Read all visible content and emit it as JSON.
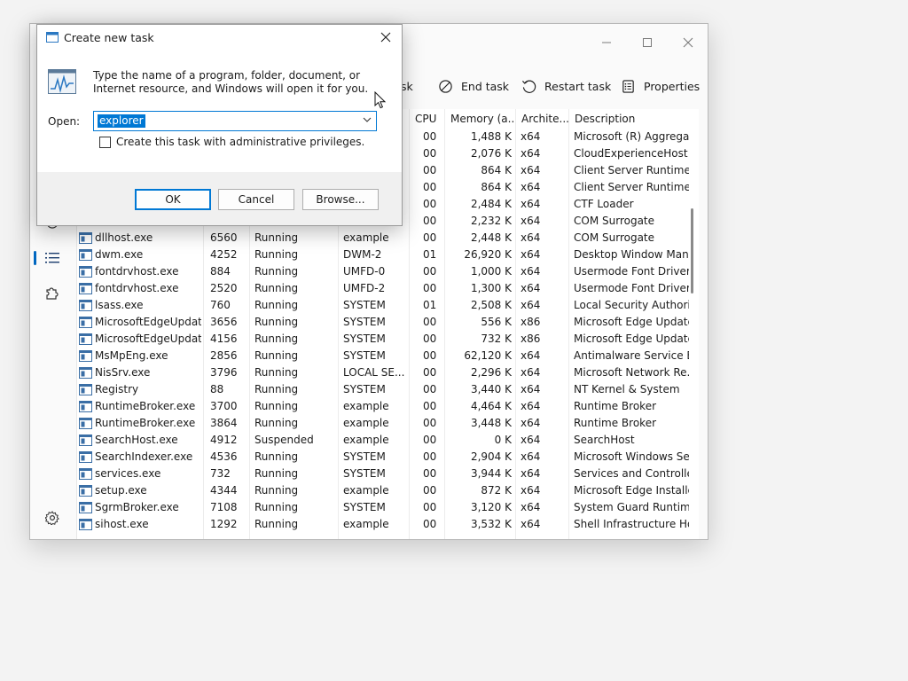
{
  "task_manager": {
    "window_controls": {
      "minimize": "—",
      "maximize": "☐",
      "close": "✕"
    },
    "toolbar": {
      "partial_label": "sk",
      "end_task": "End task",
      "restart_task": "Restart task",
      "properties": "Properties"
    },
    "columns": {
      "cpu": "CPU",
      "memory": "Memory (a...",
      "architecture": "Archite...",
      "description": "Description"
    },
    "rows": [
      {
        "name": "",
        "pid": "",
        "status": "",
        "user": "",
        "cpu": "00",
        "memory": "1,488 K",
        "arch": "x64",
        "desc": "Microsoft (R) Aggrega..."
      },
      {
        "name": "",
        "pid": "",
        "status": "",
        "user": "",
        "cpu": "00",
        "memory": "2,076 K",
        "arch": "x64",
        "desc": "CloudExperienceHost ..."
      },
      {
        "name": "",
        "pid": "",
        "status": "",
        "user": "",
        "cpu": "00",
        "memory": "864 K",
        "arch": "x64",
        "desc": "Client Server Runtime ..."
      },
      {
        "name": "",
        "pid": "",
        "status": "",
        "user": "",
        "cpu": "00",
        "memory": "864 K",
        "arch": "x64",
        "desc": "Client Server Runtime ..."
      },
      {
        "name": "",
        "pid": "",
        "status": "",
        "user": "",
        "cpu": "00",
        "memory": "2,484 K",
        "arch": "x64",
        "desc": "CTF Loader"
      },
      {
        "name": "",
        "pid": "",
        "status": "",
        "user": "",
        "cpu": "00",
        "memory": "2,232 K",
        "arch": "x64",
        "desc": "COM Surrogate"
      },
      {
        "name": "dllhost.exe",
        "pid": "6560",
        "status": "Running",
        "user": "example",
        "cpu": "00",
        "memory": "2,448 K",
        "arch": "x64",
        "desc": "COM Surrogate"
      },
      {
        "name": "dwm.exe",
        "pid": "4252",
        "status": "Running",
        "user": "DWM-2",
        "cpu": "01",
        "memory": "26,920 K",
        "arch": "x64",
        "desc": "Desktop Window Man..."
      },
      {
        "name": "fontdrvhost.exe",
        "pid": "884",
        "status": "Running",
        "user": "UMFD-0",
        "cpu": "00",
        "memory": "1,000 K",
        "arch": "x64",
        "desc": "Usermode Font Driver ..."
      },
      {
        "name": "fontdrvhost.exe",
        "pid": "2520",
        "status": "Running",
        "user": "UMFD-2",
        "cpu": "00",
        "memory": "1,300 K",
        "arch": "x64",
        "desc": "Usermode Font Driver ..."
      },
      {
        "name": "lsass.exe",
        "pid": "760",
        "status": "Running",
        "user": "SYSTEM",
        "cpu": "01",
        "memory": "2,508 K",
        "arch": "x64",
        "desc": "Local Security Authori..."
      },
      {
        "name": "MicrosoftEdgeUpdat...",
        "pid": "3656",
        "status": "Running",
        "user": "SYSTEM",
        "cpu": "00",
        "memory": "556 K",
        "arch": "x86",
        "desc": "Microsoft Edge Update"
      },
      {
        "name": "MicrosoftEdgeUpdat...",
        "pid": "4156",
        "status": "Running",
        "user": "SYSTEM",
        "cpu": "00",
        "memory": "732 K",
        "arch": "x86",
        "desc": "Microsoft Edge Update"
      },
      {
        "name": "MsMpEng.exe",
        "pid": "2856",
        "status": "Running",
        "user": "SYSTEM",
        "cpu": "00",
        "memory": "62,120 K",
        "arch": "x64",
        "desc": "Antimalware Service E..."
      },
      {
        "name": "NisSrv.exe",
        "pid": "3796",
        "status": "Running",
        "user": "LOCAL SE...",
        "cpu": "00",
        "memory": "2,296 K",
        "arch": "x64",
        "desc": "Microsoft Network Re..."
      },
      {
        "name": "Registry",
        "pid": "88",
        "status": "Running",
        "user": "SYSTEM",
        "cpu": "00",
        "memory": "3,440 K",
        "arch": "x64",
        "desc": "NT Kernel & System"
      },
      {
        "name": "RuntimeBroker.exe",
        "pid": "3700",
        "status": "Running",
        "user": "example",
        "cpu": "00",
        "memory": "4,464 K",
        "arch": "x64",
        "desc": "Runtime Broker"
      },
      {
        "name": "RuntimeBroker.exe",
        "pid": "3864",
        "status": "Running",
        "user": "example",
        "cpu": "00",
        "memory": "3,448 K",
        "arch": "x64",
        "desc": "Runtime Broker"
      },
      {
        "name": "SearchHost.exe",
        "pid": "4912",
        "status": "Suspended",
        "user": "example",
        "cpu": "00",
        "memory": "0 K",
        "arch": "x64",
        "desc": "SearchHost"
      },
      {
        "name": "SearchIndexer.exe",
        "pid": "4536",
        "status": "Running",
        "user": "SYSTEM",
        "cpu": "00",
        "memory": "2,904 K",
        "arch": "x64",
        "desc": "Microsoft Windows Se..."
      },
      {
        "name": "services.exe",
        "pid": "732",
        "status": "Running",
        "user": "SYSTEM",
        "cpu": "00",
        "memory": "3,944 K",
        "arch": "x64",
        "desc": "Services and Controlle..."
      },
      {
        "name": "setup.exe",
        "pid": "4344",
        "status": "Running",
        "user": "example",
        "cpu": "00",
        "memory": "872 K",
        "arch": "x64",
        "desc": "Microsoft Edge Installer"
      },
      {
        "name": "SgrmBroker.exe",
        "pid": "7108",
        "status": "Running",
        "user": "SYSTEM",
        "cpu": "00",
        "memory": "3,120 K",
        "arch": "x64",
        "desc": "System Guard Runtim..."
      },
      {
        "name": "sihost.exe",
        "pid": "1292",
        "status": "Running",
        "user": "example",
        "cpu": "00",
        "memory": "3,532 K",
        "arch": "x64",
        "desc": "Shell Infrastructure Host"
      }
    ]
  },
  "dialog": {
    "title": "Create new task",
    "close": "✕",
    "description": "Type the name of a program, folder, document, or Internet resource, and Windows will open it for you.",
    "open_label": "Open:",
    "open_value": "explorer",
    "admin_label": "Create this task with administrative privileges.",
    "ok": "OK",
    "cancel": "Cancel",
    "browse": "Browse..."
  },
  "colors": {
    "accent": "#0078d4",
    "nav_active": "#0067c0"
  }
}
